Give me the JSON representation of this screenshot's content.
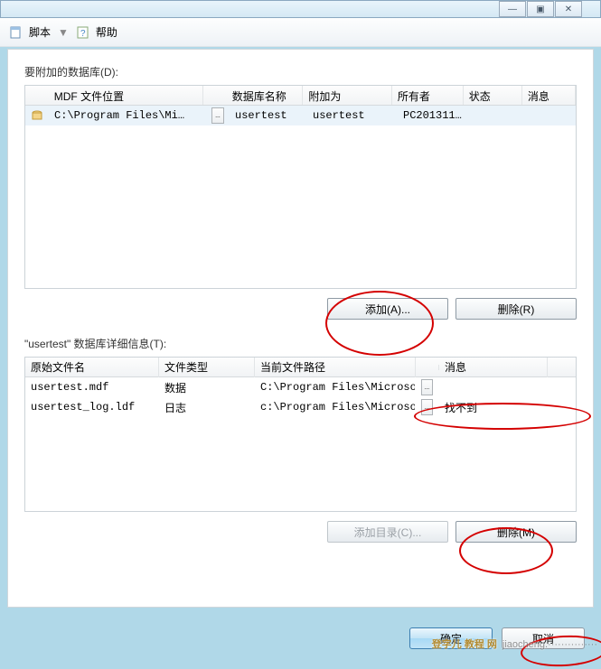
{
  "titlebar": {
    "min": "—",
    "max": "▣",
    "close": "✕"
  },
  "toolbar": {
    "script_label": "脚本",
    "dropdown": "▼",
    "help_label": "帮助"
  },
  "section1": {
    "label": "要附加的数据库(D):",
    "headers": {
      "mdf": "MDF 文件位置",
      "dbname": "数据库名称",
      "attachas": "附加为",
      "owner": "所有者",
      "status": "状态",
      "message": "消息"
    },
    "row": {
      "mdf": "C:\\Program Files\\Mi…",
      "browse": "…",
      "dbname": "usertest",
      "attachas": "usertest",
      "owner": "PC201311…"
    },
    "add_btn": "添加(A)...",
    "remove_btn": "删除(R)"
  },
  "section2": {
    "label": "\"usertest\" 数据库详细信息(T):",
    "headers": {
      "orig": "原始文件名",
      "ftype": "文件类型",
      "curpath": "当前文件路径",
      "message": "消息"
    },
    "rows": [
      {
        "orig": "usertest.mdf",
        "ftype": "数据",
        "curpath": "C:\\Program Files\\Microsof…",
        "browse": "…",
        "message": ""
      },
      {
        "orig": "usertest_log.ldf",
        "ftype": "日志",
        "curpath": "c:\\Program Files\\Microsof…",
        "browse": "…",
        "message": "找不到"
      }
    ],
    "adddir_btn": "添加目录(C)...",
    "remove_btn": "删除(M)"
  },
  "dialog": {
    "ok": "确定",
    "cancel": "取消"
  },
  "watermark": {
    "cn": "登字儿 教程 网",
    "url": "jiaocheng.···············"
  }
}
